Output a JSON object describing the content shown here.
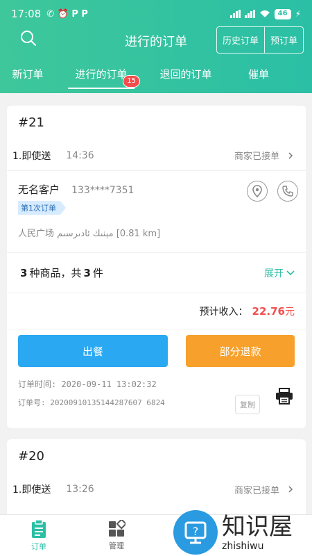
{
  "status_bar": {
    "time": "17:08",
    "left_glyphs": "✆ ⏰ P P",
    "battery": "46"
  },
  "header": {
    "title": "进行的订单",
    "history_btn": "历史订单",
    "preorder_btn": "预订单"
  },
  "tabs": [
    {
      "label": "新订单"
    },
    {
      "label": "进行的订单",
      "badge": "15"
    },
    {
      "label": "退回的订单"
    },
    {
      "label": "催单"
    }
  ],
  "colors": {
    "accent": "#2bbfa6",
    "danger": "#f24e4e",
    "blue_button": "#2aa8f2",
    "orange_button": "#f7a02b"
  },
  "orders": [
    {
      "number": "#21",
      "type": "1.即使送",
      "time": "14:36",
      "status": "商家已接单",
      "customer_name": "无名客户",
      "customer_phone": "133****7351",
      "first_order_tag": "第1次订单",
      "address": "人民广场 مېنىك ئادىرسىم [0.81 km]",
      "goods_prefix_count": "3",
      "goods_text_1": "种商品，共",
      "goods_qty": "3",
      "goods_text_2": "件",
      "expand_label": "展开",
      "income_label": "预计收入：",
      "income_amount": "22.76",
      "income_unit": "元",
      "serve_btn": "出餐",
      "refund_btn": "部分退款",
      "order_time": "订单时间: 2020-09-11 13:02:32",
      "order_no": "订单号: 20200910135144287607 6824",
      "copy_label": "复制"
    },
    {
      "number": "#20",
      "type": "1.即使送",
      "time": "13:26",
      "status": "商家已接单"
    }
  ],
  "bottom_nav": [
    {
      "label": "订单",
      "icon": "clipboard-icon",
      "active": true
    },
    {
      "label": "管理",
      "icon": "grid-icon",
      "active": false
    }
  ],
  "watermark": {
    "cn": "知识屋",
    "en": "zhishiwu"
  }
}
